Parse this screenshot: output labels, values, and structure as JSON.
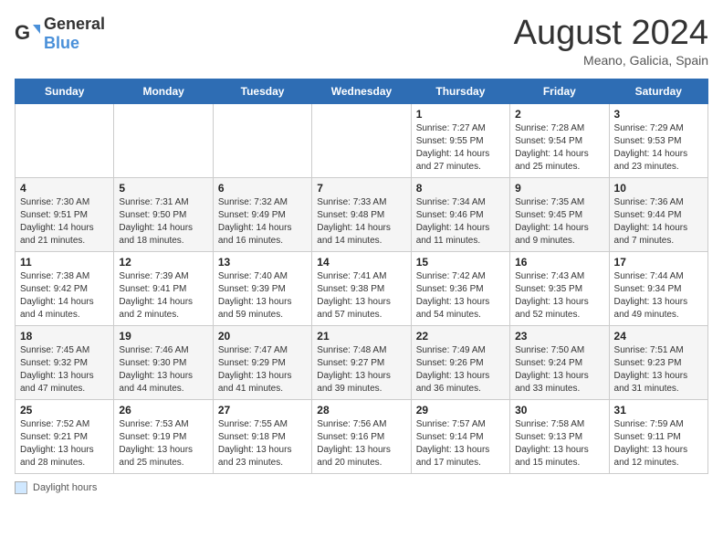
{
  "header": {
    "logo_general": "General",
    "logo_blue": "Blue",
    "title": "August 2024",
    "location": "Meano, Galicia, Spain"
  },
  "days_of_week": [
    "Sunday",
    "Monday",
    "Tuesday",
    "Wednesday",
    "Thursday",
    "Friday",
    "Saturday"
  ],
  "weeks": [
    [
      {
        "day": "",
        "info": ""
      },
      {
        "day": "",
        "info": ""
      },
      {
        "day": "",
        "info": ""
      },
      {
        "day": "",
        "info": ""
      },
      {
        "day": "1",
        "info": "Sunrise: 7:27 AM\nSunset: 9:55 PM\nDaylight: 14 hours and 27 minutes."
      },
      {
        "day": "2",
        "info": "Sunrise: 7:28 AM\nSunset: 9:54 PM\nDaylight: 14 hours and 25 minutes."
      },
      {
        "day": "3",
        "info": "Sunrise: 7:29 AM\nSunset: 9:53 PM\nDaylight: 14 hours and 23 minutes."
      }
    ],
    [
      {
        "day": "4",
        "info": "Sunrise: 7:30 AM\nSunset: 9:51 PM\nDaylight: 14 hours and 21 minutes."
      },
      {
        "day": "5",
        "info": "Sunrise: 7:31 AM\nSunset: 9:50 PM\nDaylight: 14 hours and 18 minutes."
      },
      {
        "day": "6",
        "info": "Sunrise: 7:32 AM\nSunset: 9:49 PM\nDaylight: 14 hours and 16 minutes."
      },
      {
        "day": "7",
        "info": "Sunrise: 7:33 AM\nSunset: 9:48 PM\nDaylight: 14 hours and 14 minutes."
      },
      {
        "day": "8",
        "info": "Sunrise: 7:34 AM\nSunset: 9:46 PM\nDaylight: 14 hours and 11 minutes."
      },
      {
        "day": "9",
        "info": "Sunrise: 7:35 AM\nSunset: 9:45 PM\nDaylight: 14 hours and 9 minutes."
      },
      {
        "day": "10",
        "info": "Sunrise: 7:36 AM\nSunset: 9:44 PM\nDaylight: 14 hours and 7 minutes."
      }
    ],
    [
      {
        "day": "11",
        "info": "Sunrise: 7:38 AM\nSunset: 9:42 PM\nDaylight: 14 hours and 4 minutes."
      },
      {
        "day": "12",
        "info": "Sunrise: 7:39 AM\nSunset: 9:41 PM\nDaylight: 14 hours and 2 minutes."
      },
      {
        "day": "13",
        "info": "Sunrise: 7:40 AM\nSunset: 9:39 PM\nDaylight: 13 hours and 59 minutes."
      },
      {
        "day": "14",
        "info": "Sunrise: 7:41 AM\nSunset: 9:38 PM\nDaylight: 13 hours and 57 minutes."
      },
      {
        "day": "15",
        "info": "Sunrise: 7:42 AM\nSunset: 9:36 PM\nDaylight: 13 hours and 54 minutes."
      },
      {
        "day": "16",
        "info": "Sunrise: 7:43 AM\nSunset: 9:35 PM\nDaylight: 13 hours and 52 minutes."
      },
      {
        "day": "17",
        "info": "Sunrise: 7:44 AM\nSunset: 9:34 PM\nDaylight: 13 hours and 49 minutes."
      }
    ],
    [
      {
        "day": "18",
        "info": "Sunrise: 7:45 AM\nSunset: 9:32 PM\nDaylight: 13 hours and 47 minutes."
      },
      {
        "day": "19",
        "info": "Sunrise: 7:46 AM\nSunset: 9:30 PM\nDaylight: 13 hours and 44 minutes."
      },
      {
        "day": "20",
        "info": "Sunrise: 7:47 AM\nSunset: 9:29 PM\nDaylight: 13 hours and 41 minutes."
      },
      {
        "day": "21",
        "info": "Sunrise: 7:48 AM\nSunset: 9:27 PM\nDaylight: 13 hours and 39 minutes."
      },
      {
        "day": "22",
        "info": "Sunrise: 7:49 AM\nSunset: 9:26 PM\nDaylight: 13 hours and 36 minutes."
      },
      {
        "day": "23",
        "info": "Sunrise: 7:50 AM\nSunset: 9:24 PM\nDaylight: 13 hours and 33 minutes."
      },
      {
        "day": "24",
        "info": "Sunrise: 7:51 AM\nSunset: 9:23 PM\nDaylight: 13 hours and 31 minutes."
      }
    ],
    [
      {
        "day": "25",
        "info": "Sunrise: 7:52 AM\nSunset: 9:21 PM\nDaylight: 13 hours and 28 minutes."
      },
      {
        "day": "26",
        "info": "Sunrise: 7:53 AM\nSunset: 9:19 PM\nDaylight: 13 hours and 25 minutes."
      },
      {
        "day": "27",
        "info": "Sunrise: 7:55 AM\nSunset: 9:18 PM\nDaylight: 13 hours and 23 minutes."
      },
      {
        "day": "28",
        "info": "Sunrise: 7:56 AM\nSunset: 9:16 PM\nDaylight: 13 hours and 20 minutes."
      },
      {
        "day": "29",
        "info": "Sunrise: 7:57 AM\nSunset: 9:14 PM\nDaylight: 13 hours and 17 minutes."
      },
      {
        "day": "30",
        "info": "Sunrise: 7:58 AM\nSunset: 9:13 PM\nDaylight: 13 hours and 15 minutes."
      },
      {
        "day": "31",
        "info": "Sunrise: 7:59 AM\nSunset: 9:11 PM\nDaylight: 13 hours and 12 minutes."
      }
    ]
  ],
  "legend": {
    "label": "Daylight hours"
  }
}
